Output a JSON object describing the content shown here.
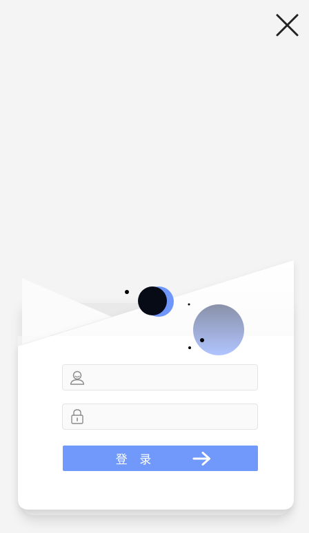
{
  "dialog": {
    "close_icon": "close-icon"
  },
  "login_form": {
    "username_icon": "user-icon",
    "username_value": "",
    "password_icon": "lock-icon",
    "password_value": "",
    "submit_label": "登 录",
    "submit_icon": "arrow-right-icon"
  },
  "colors": {
    "background": "#f4f4f4",
    "card": "#ffffff",
    "accent": "#7099fb",
    "orb_dark": "#060b16",
    "orb_gradient_top": "#8a91a8",
    "orb_gradient_bottom": "#b0c4ff"
  }
}
